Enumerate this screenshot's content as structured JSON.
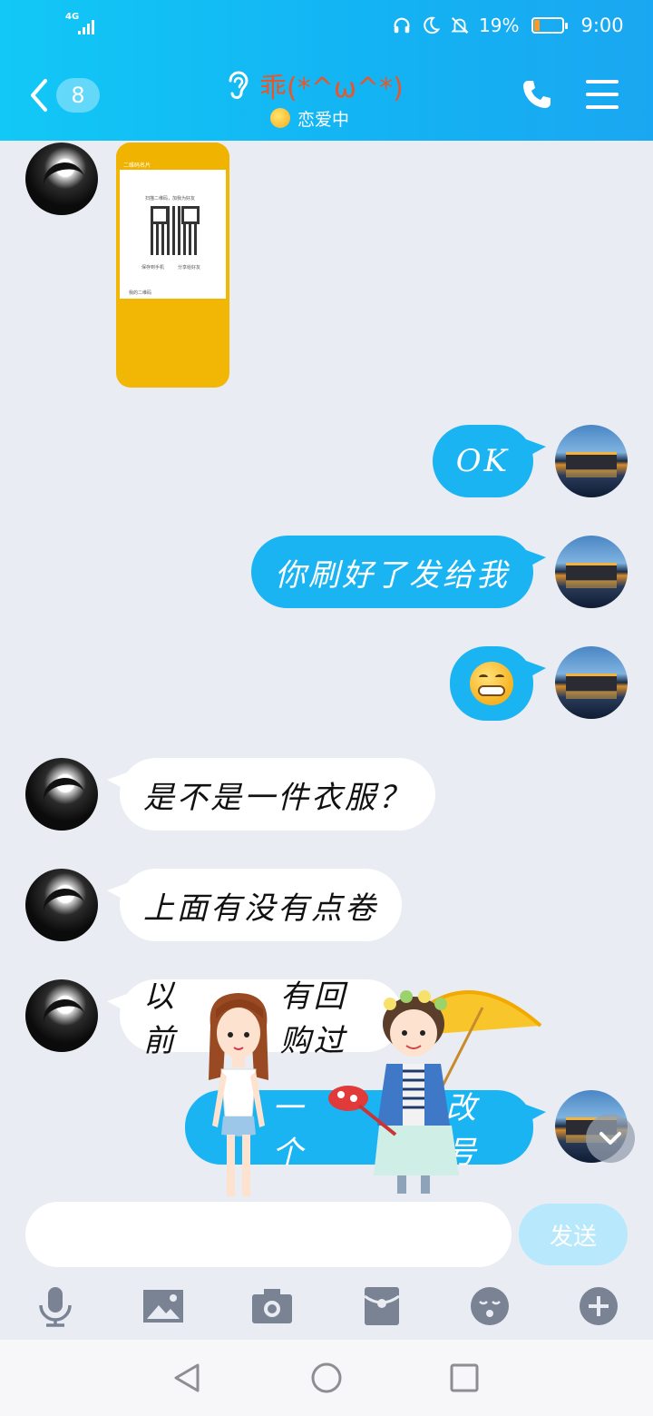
{
  "status_bar": {
    "network": "4G",
    "battery": "19%",
    "battery_level": 0.19,
    "time": "9:00",
    "icons": [
      "headset-icon",
      "moon-icon",
      "bell-off-icon"
    ]
  },
  "header": {
    "unread_count": "8",
    "title": "乖(*^ω^*)",
    "subtitle": "恋爱中",
    "icons": {
      "back": "chevron-left-icon",
      "ear": "ear-icon",
      "call": "phone-icon",
      "menu": "menu-icon"
    }
  },
  "messages": [
    {
      "side": "left",
      "type": "image",
      "preview": {
        "header": "二维码名片",
        "line": "扫描二维码，加我为好友",
        "left_btn": "保存到手机",
        "right_btn": "分享给好友",
        "footer": "我的二维码"
      }
    },
    {
      "side": "right",
      "type": "text",
      "text": "OK"
    },
    {
      "side": "right",
      "type": "text",
      "text": "你刷好了发给我"
    },
    {
      "side": "right",
      "type": "emoji",
      "emoji": "grinning-face"
    },
    {
      "side": "left",
      "type": "text",
      "text": "是不是一件衣服？"
    },
    {
      "side": "left",
      "type": "text",
      "text": "上面有没有点卷"
    },
    {
      "side": "left",
      "type": "text",
      "text": "以前"
    },
    {
      "side": "left",
      "type": "text",
      "text": "有回购过"
    },
    {
      "side": "right",
      "type": "text",
      "text": "一个"
    },
    {
      "side": "right",
      "type": "text",
      "text": "改号"
    }
  ],
  "composer": {
    "input_value": "",
    "input_placeholder": "",
    "send_label": "发送",
    "tools": [
      "microphone-icon",
      "image-icon",
      "camera-icon",
      "red-packet-icon",
      "emoji-icon",
      "plus-icon"
    ]
  },
  "navbar": [
    "back-triangle-icon",
    "home-circle-icon",
    "recents-square-icon"
  ],
  "colors": {
    "header_gradient_start": "#12c8f6",
    "header_gradient_end": "#1aa7f1",
    "title": "#e8562c",
    "bubble_self": "#1ab4f3",
    "bubble_other": "#ffffff",
    "background": "#e9ecf3",
    "send_button": "#b7e8fb"
  }
}
